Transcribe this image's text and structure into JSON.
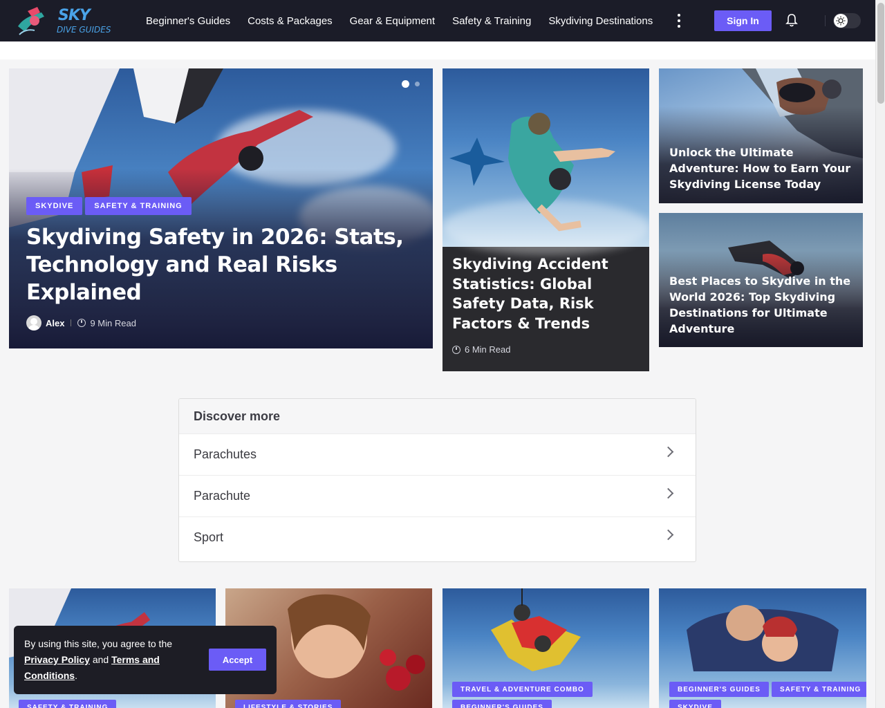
{
  "brand": {
    "line1": "SKY",
    "line2": "DIVE GUIDES"
  },
  "nav": [
    "Beginner's Guides",
    "Costs & Packages",
    "Gear & Equipment",
    "Safety & Training",
    "Skydiving Destinations"
  ],
  "header": {
    "signin_label": "Sign In"
  },
  "hero": {
    "tags": [
      "SKYDIVE",
      "SAFETY & TRAINING"
    ],
    "title": "Skydiving Safety in 2026: Stats, Technology and Real Risks Explained",
    "author": "Alex",
    "read_time": "9 Min Read"
  },
  "mid": {
    "title": "Skydiving Accident Statistics: Global Safety Data, Risk Factors & Trends",
    "read_time": "6 Min Read"
  },
  "side1": {
    "title": "Unlock the Ultimate Adventure: How to Earn Your Skydiving License Today"
  },
  "side2": {
    "title": "Best Places to Skydive in the World 2026: Top Skydiving Destinations for Ultimate Adventure"
  },
  "discover": {
    "title": "Discover more",
    "items": [
      "Parachutes",
      "Parachute",
      "Sport"
    ]
  },
  "bottom": {
    "card1_tags": [
      "SAFETY & TRAINING"
    ],
    "card2_tags": [
      "LIFESTYLE & STORIES"
    ],
    "card3_tags": [
      "TRAVEL & ADVENTURE COMBO",
      "BEGINNER'S GUIDES"
    ],
    "card4_tags": [
      "BEGINNER'S GUIDES",
      "SAFETY & TRAINING",
      "SKYDIVE"
    ]
  },
  "cookie": {
    "text_before": "By using this site, you agree to the ",
    "privacy": "Privacy Policy",
    "and": " and ",
    "terms": "Terms and Conditions",
    "period": ".",
    "accept": "Accept"
  },
  "colors": {
    "accent": "#6b5cf6",
    "header_bg": "#1b1c28"
  }
}
